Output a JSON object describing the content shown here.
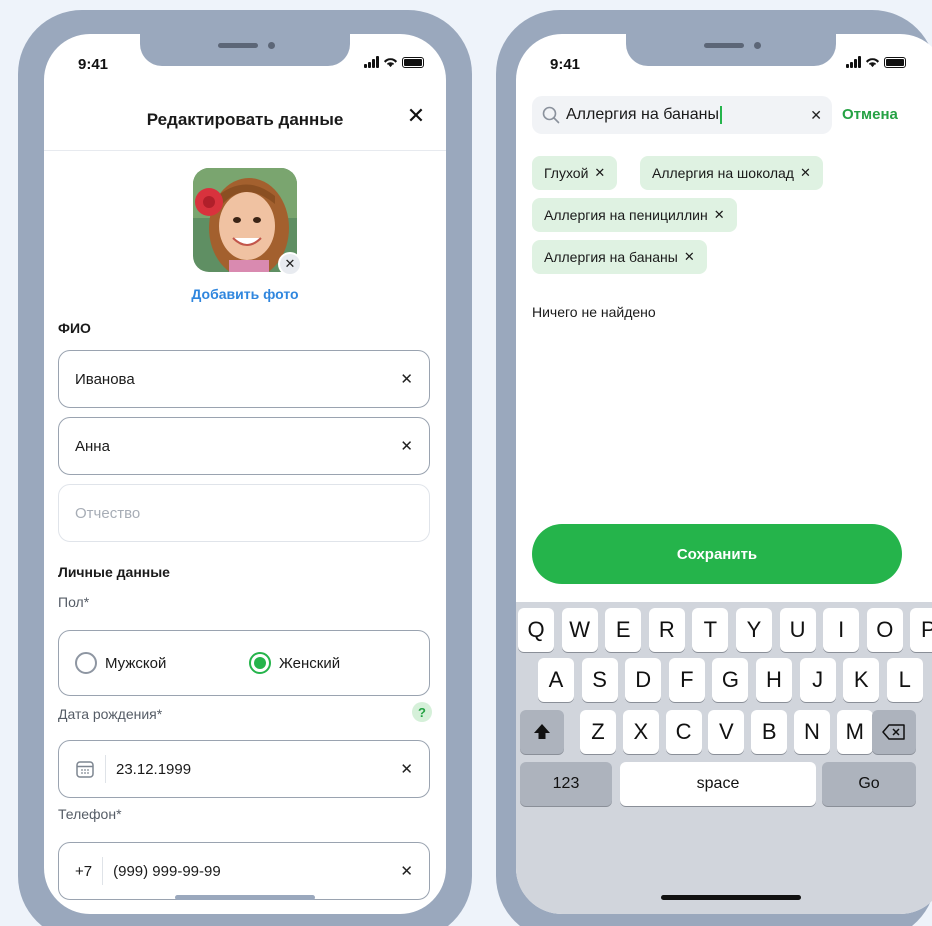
{
  "colors": {
    "accent": "#25b44b",
    "link": "#2f86de",
    "frame": "#9aa8bd"
  },
  "left": {
    "status": {
      "time": "9:41"
    },
    "header": {
      "title": "Редактировать данные",
      "close_icon": "close-icon"
    },
    "photo": {
      "add_label": "Добавить фото",
      "remove_icon": "close-icon"
    },
    "fio": {
      "section_title": "ФИО",
      "last_name": {
        "value": "Иванова"
      },
      "first_name": {
        "value": "Анна"
      },
      "middle_name": {
        "value": "",
        "placeholder": "Отчество"
      }
    },
    "personal": {
      "section_title": "Личные данные",
      "gender_label": "Пол*",
      "gender_options": [
        {
          "label": "Мужской",
          "selected": false
        },
        {
          "label": "Женский",
          "selected": true
        }
      ],
      "birth_label": "Дата рождения*",
      "birth_help": "?",
      "birth_value": "23.12.1999",
      "phone_label": "Телефон*",
      "phone_prefix": "+7",
      "phone_value": "(999) 999-99-99"
    },
    "clear_symbol": "✕"
  },
  "right": {
    "status": {
      "time": "9:41"
    },
    "search": {
      "value": "Аллергия на бананы",
      "cancel_label": "Отмена"
    },
    "chips": [
      "Глухой",
      "Аллергия на шоколад",
      "Аллергия на пенициллин",
      "Аллергия на бананы"
    ],
    "not_found": "Ничего не найдено",
    "save_label": "Сохранить",
    "keyboard": {
      "row1": [
        "Q",
        "W",
        "E",
        "R",
        "T",
        "Y",
        "U",
        "I",
        "O",
        "P"
      ],
      "row2": [
        "A",
        "S",
        "D",
        "F",
        "G",
        "H",
        "J",
        "K",
        "L"
      ],
      "row3": [
        "Z",
        "X",
        "C",
        "V",
        "B",
        "N",
        "M"
      ],
      "num_label": "123",
      "space_label": "space",
      "go_label": "Go"
    }
  }
}
